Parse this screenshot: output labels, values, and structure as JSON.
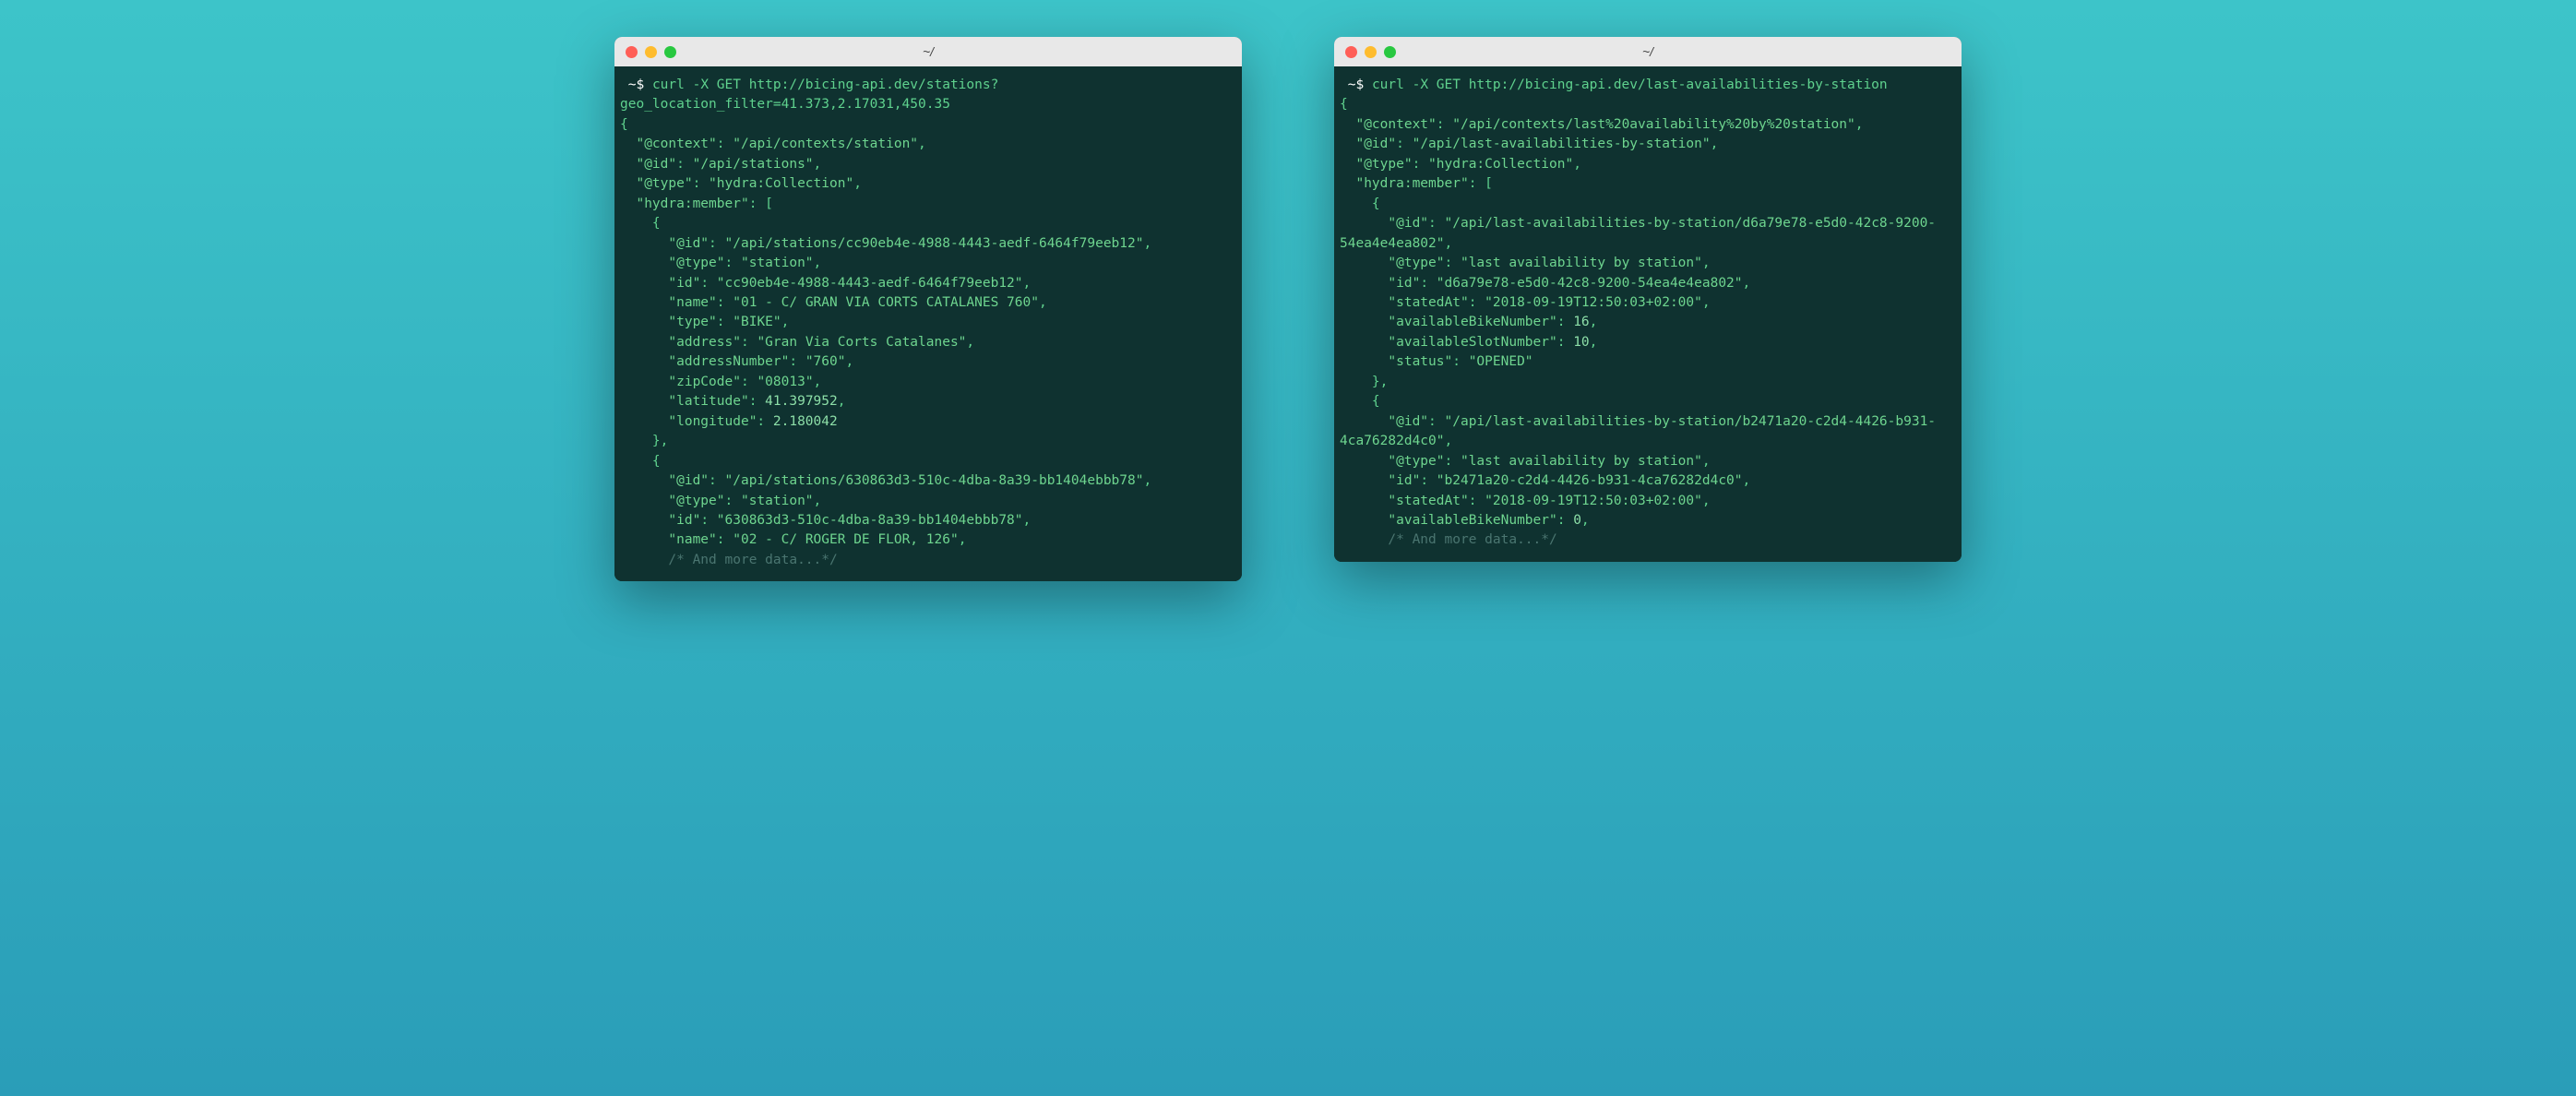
{
  "windows": [
    {
      "title": "~/",
      "prompt": "~$",
      "command": "curl -X GET http://bicing-api.dev/stations?geo_location_filter=41.373,2.17031,450.35",
      "json_lines": [
        {
          "indent": 0,
          "text": "{",
          "type": "punct"
        },
        {
          "indent": 1,
          "key": "@context",
          "val": "/api/contexts/station",
          "type": "str",
          "comma": true
        },
        {
          "indent": 1,
          "key": "@id",
          "val": "/api/stations",
          "type": "str",
          "comma": true
        },
        {
          "indent": 1,
          "key": "@type",
          "val": "hydra:Collection",
          "type": "str",
          "comma": true
        },
        {
          "indent": 1,
          "key": "hydra:member",
          "raw": "[",
          "type": "punct"
        },
        {
          "indent": 2,
          "text": "{",
          "type": "punct"
        },
        {
          "indent": 3,
          "key": "@id",
          "val": "/api/stations/cc90eb4e-4988-4443-aedf-6464f79eeb12",
          "type": "str",
          "comma": true
        },
        {
          "indent": 3,
          "key": "@type",
          "val": "station",
          "type": "str",
          "comma": true
        },
        {
          "indent": 3,
          "key": "id",
          "val": "cc90eb4e-4988-4443-aedf-6464f79eeb12",
          "type": "str",
          "comma": true
        },
        {
          "indent": 3,
          "key": "name",
          "val": "01 - C/ GRAN VIA CORTS CATALANES 760",
          "type": "str",
          "comma": true
        },
        {
          "indent": 3,
          "key": "type",
          "val": "BIKE",
          "type": "str",
          "comma": true
        },
        {
          "indent": 3,
          "key": "address",
          "val": "Gran Via Corts Catalanes",
          "type": "str",
          "comma": true
        },
        {
          "indent": 3,
          "key": "addressNumber",
          "val": "760",
          "type": "str",
          "comma": true
        },
        {
          "indent": 3,
          "key": "zipCode",
          "val": "08013",
          "type": "str",
          "comma": true
        },
        {
          "indent": 3,
          "key": "latitude",
          "val": "41.397952",
          "type": "num",
          "comma": true
        },
        {
          "indent": 3,
          "key": "longitude",
          "val": "2.180042",
          "type": "num"
        },
        {
          "indent": 2,
          "text": "},",
          "type": "punct"
        },
        {
          "indent": 2,
          "text": "{",
          "type": "punct"
        },
        {
          "indent": 3,
          "key": "@id",
          "val": "/api/stations/630863d3-510c-4dba-8a39-bb1404ebbb78",
          "type": "str",
          "comma": true
        },
        {
          "indent": 3,
          "key": "@type",
          "val": "station",
          "type": "str",
          "comma": true
        },
        {
          "indent": 3,
          "key": "id",
          "val": "630863d3-510c-4dba-8a39-bb1404ebbb78",
          "type": "str",
          "comma": true
        },
        {
          "indent": 3,
          "key": "name",
          "val": "02 - C/ ROGER DE FLOR, 126",
          "type": "str",
          "comma": true
        },
        {
          "indent": 3,
          "text": "/* And more data...*/",
          "type": "comment"
        }
      ]
    },
    {
      "title": "~/",
      "prompt": "~$",
      "command": "curl -X GET http://bicing-api.dev/last-availabilities-by-station",
      "json_lines": [
        {
          "indent": 0,
          "text": "{",
          "type": "punct"
        },
        {
          "indent": 1,
          "key": "@context",
          "val": "/api/contexts/last%20availability%20by%20station",
          "type": "str",
          "comma": true
        },
        {
          "indent": 1,
          "key": "@id",
          "val": "/api/last-availabilities-by-station",
          "type": "str",
          "comma": true
        },
        {
          "indent": 1,
          "key": "@type",
          "val": "hydra:Collection",
          "type": "str",
          "comma": true
        },
        {
          "indent": 1,
          "key": "hydra:member",
          "raw": "[",
          "type": "punct"
        },
        {
          "indent": 2,
          "text": "{",
          "type": "punct"
        },
        {
          "indent": 3,
          "key": "@id",
          "val": "/api/last-availabilities-by-station/d6a79e78-e5d0-42c8-9200-54ea4e4ea802",
          "type": "str",
          "comma": true,
          "wrap": true,
          "wrapPrefix": ""
        },
        {
          "indent": 3,
          "key": "@type",
          "val": "last availability by station",
          "type": "str",
          "comma": true
        },
        {
          "indent": 3,
          "key": "id",
          "val": "d6a79e78-e5d0-42c8-9200-54ea4e4ea802",
          "type": "str",
          "comma": true
        },
        {
          "indent": 3,
          "key": "statedAt",
          "val": "2018-09-19T12:50:03+02:00",
          "type": "str",
          "comma": true
        },
        {
          "indent": 3,
          "key": "availableBikeNumber",
          "val": "16",
          "type": "num",
          "comma": true
        },
        {
          "indent": 3,
          "key": "availableSlotNumber",
          "val": "10",
          "type": "num",
          "comma": true
        },
        {
          "indent": 3,
          "key": "status",
          "val": "OPENED",
          "type": "str"
        },
        {
          "indent": 2,
          "text": "},",
          "type": "punct"
        },
        {
          "indent": 2,
          "text": "{",
          "type": "punct"
        },
        {
          "indent": 3,
          "key": "@id",
          "val": "/api/last-availabilities-by-station/b2471a20-c2d4-4426-b931-4ca76282d4c0",
          "type": "str",
          "comma": true,
          "wrap": true
        },
        {
          "indent": 3,
          "key": "@type",
          "val": "last availability by station",
          "type": "str",
          "comma": true
        },
        {
          "indent": 3,
          "key": "id",
          "val": "b2471a20-c2d4-4426-b931-4ca76282d4c0",
          "type": "str",
          "comma": true
        },
        {
          "indent": 3,
          "key": "statedAt",
          "val": "2018-09-19T12:50:03+02:00",
          "type": "str",
          "comma": true
        },
        {
          "indent": 3,
          "key": "availableBikeNumber",
          "val": "0",
          "type": "num",
          "comma": true
        },
        {
          "indent": 3,
          "text": "/* And more data...*/",
          "type": "comment"
        }
      ]
    }
  ]
}
